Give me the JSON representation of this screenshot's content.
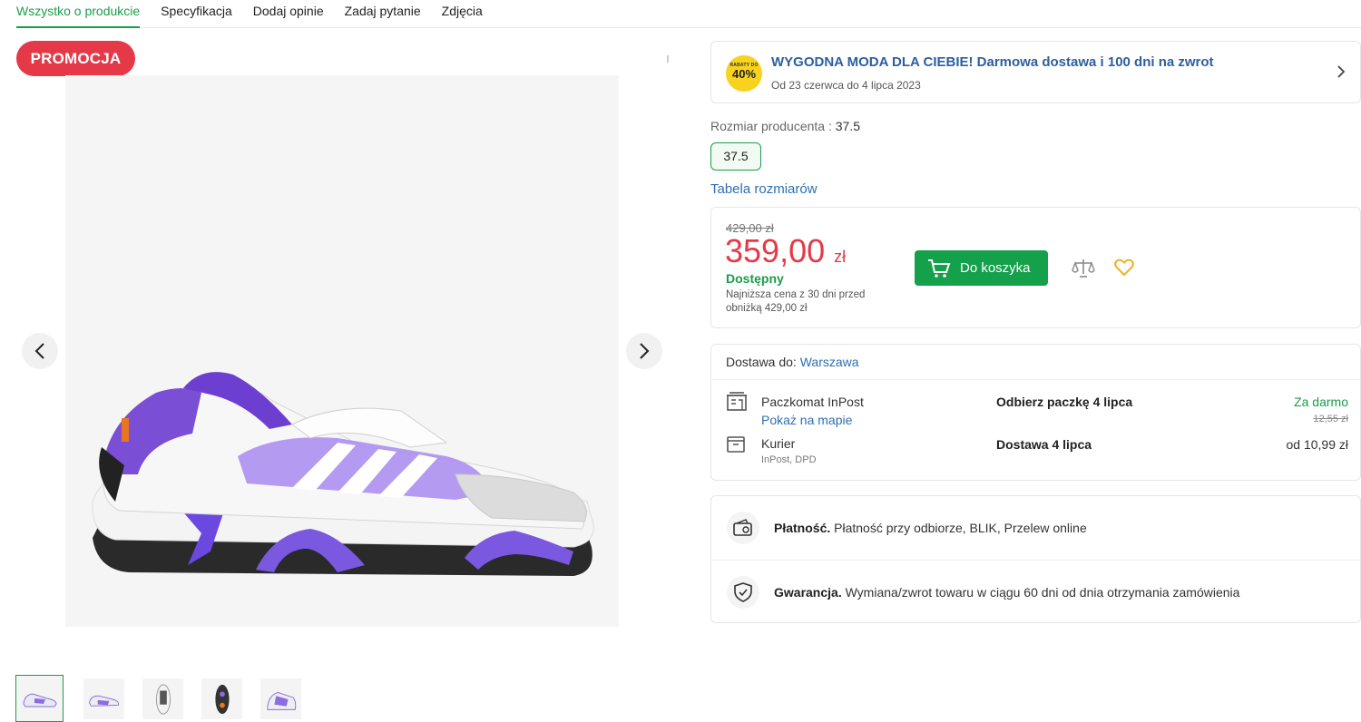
{
  "tabs": [
    {
      "label": "Wszystko o produkcie"
    },
    {
      "label": "Specyfikacja"
    },
    {
      "label": "Dodaj opinie"
    },
    {
      "label": "Zadaj pytanie"
    },
    {
      "label": "Zdjęcia"
    }
  ],
  "gallery": {
    "promo_badge": "PROMOCJA",
    "thumbnail_count": 5,
    "active_thumbnail": 1
  },
  "promo_banner": {
    "badge_small": "RABATY DO",
    "badge_percent": "40%",
    "title": "WYGODNA MODA DLA CIEBIE! Darmowa dostawa i 100 dni na zwrot",
    "dates": "Od 23 czerwca do 4 lipca 2023"
  },
  "size": {
    "label": "Rozmiar producenta",
    "value": "37.5",
    "option": "37.5",
    "table_link": "Tabela rozmiarów"
  },
  "price": {
    "old": "429,00 zł",
    "current": "359,00",
    "currency": "zł",
    "availability": "Dostępny",
    "lowest_note": "Najniższa cena z 30 dni przed obniżką 429,00 zł",
    "cart_button": "Do koszyka"
  },
  "delivery": {
    "header_label": "Dostawa do:",
    "city": "Warszawa",
    "options": [
      {
        "name": "Paczkomat InPost",
        "link": "Pokaż na mapie",
        "when": "Odbierz paczkę 4 lipca",
        "price": "Za darmo",
        "old_price": "12,55 zł"
      },
      {
        "name": "Kurier",
        "sub": "InPost, DPD",
        "when": "Dostawa 4 lipca",
        "price": "od 10,99 zł"
      }
    ]
  },
  "info": {
    "payment_title": "Płatność.",
    "payment_text": "Płatność przy odbiorze, BLIK, Przelew online",
    "warranty_title": "Gwarancja.",
    "warranty_text": "Wymiana/zwrot towaru w ciągu 60 dni od dnia otrzymania zamówienia"
  },
  "colors": {
    "accent_green": "#1a9d4a",
    "price_red": "#e53948",
    "link_blue": "#2c6fb2",
    "badge_yellow": "#f7d21e"
  }
}
